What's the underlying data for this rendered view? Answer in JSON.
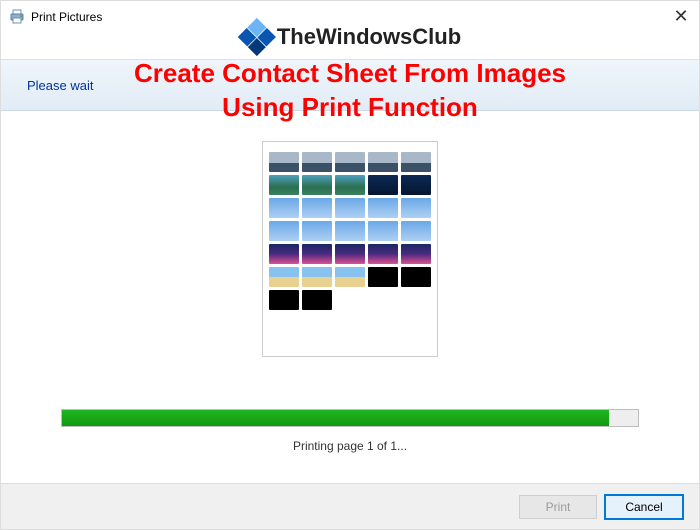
{
  "window": {
    "title": "Print Pictures",
    "close_icon_glyph": "✕"
  },
  "branding": {
    "name": "TheWindowsClub"
  },
  "headline": {
    "line1": "Create Contact Sheet From Images",
    "line2": "Using Print Function"
  },
  "waitbar": {
    "text": "Please wait"
  },
  "progress": {
    "percent": 95
  },
  "status": {
    "text": "Printing page 1 of 1..."
  },
  "footer": {
    "print_label": "Print",
    "cancel_label": "Cancel"
  },
  "colors": {
    "accent_red": "#ff0000",
    "link_blue": "#00349a",
    "progress_green": "#14a514",
    "focus_blue": "#0078d7"
  }
}
